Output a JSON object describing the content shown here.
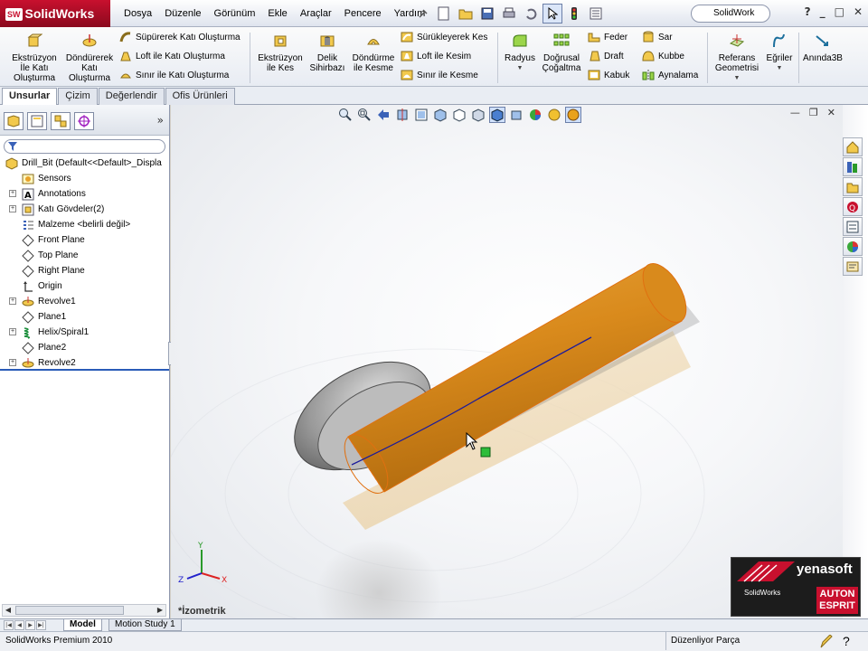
{
  "app": {
    "brand": "SolidWorks",
    "brand_badge": "SW",
    "menu": [
      "Dosya",
      "Düzenle",
      "Görünüm",
      "Ekle",
      "Araçlar",
      "Pencere",
      "Yardım"
    ],
    "search_placeholder": "SolidWork",
    "help_label": "?",
    "window_buttons": [
      "_",
      "□",
      "✕"
    ]
  },
  "commands": {
    "extrude_boss": "Ekstrüzyon İle Katı Oluşturma",
    "revolve_boss": "Döndürerek Katı Oluşturma",
    "sweep_boss": "Süpürerek Katı Oluşturma",
    "loft_boss": "Loft ile Katı Oluşturma",
    "boundary_boss": "Sınır ile Katı Oluşturma",
    "extrude_cut": "Ekstrüzyon ile Kes",
    "hole_wizard": "Delik Sihirbazı",
    "revolve_cut": "Döndürme ile Kesme",
    "sweep_cut": "Sürükleyerek Kes",
    "loft_cut": "Loft ile Kesim",
    "boundary_cut": "Sınır ile Kesme",
    "fillet": "Radyus",
    "linear_pattern": "Doğrusal Çoğaltma",
    "rib": "Feder",
    "draft": "Draft",
    "shell": "Kabuk",
    "wrap": "Sar",
    "dome": "Kubbe",
    "mirror": "Aynalama",
    "reference_geometry": "Referans Geometrisi",
    "curves": "Eğriler",
    "instant3d": "Anında3B"
  },
  "tabs": [
    "Unsurlar",
    "Çizim",
    "Değerlendir",
    "Ofis Ürünleri"
  ],
  "active_tab": "Unsurlar",
  "tree": {
    "root": "Drill_Bit  (Default<<Default>_Displa",
    "items": [
      {
        "label": "Sensors",
        "expandable": false
      },
      {
        "label": "Annotations",
        "expandable": true
      },
      {
        "label": "Katı Gövdeler(2)",
        "expandable": true
      },
      {
        "label": "Malzeme <belirli değil>",
        "expandable": false
      },
      {
        "label": "Front Plane",
        "expandable": false
      },
      {
        "label": "Top Plane",
        "expandable": false
      },
      {
        "label": "Right Plane",
        "expandable": false
      },
      {
        "label": "Origin",
        "expandable": false
      },
      {
        "label": "Revolve1",
        "expandable": true
      },
      {
        "label": "Plane1",
        "expandable": false
      },
      {
        "label": "Helix/Spiral1",
        "expandable": true
      },
      {
        "label": "Plane2",
        "expandable": false
      },
      {
        "label": "Revolve2",
        "expandable": true
      }
    ]
  },
  "viewport": {
    "view_name": "*İzometrik",
    "triad_labels": {
      "x": "X",
      "y": "Y",
      "z": "Z"
    }
  },
  "bottom_tabs": [
    "Model",
    "Motion Study 1"
  ],
  "status": {
    "version": "SolidWorks Premium 2010",
    "mode": "Düzenliyor Parça"
  },
  "watermark": {
    "company": "yenasoft",
    "sw_label": "SolidWorks",
    "partner_line1": "AUTON",
    "partner_line2": "ESPRIT"
  },
  "colors": {
    "brand_red": "#c8102e",
    "part_orange": "#d98a1c",
    "helix_blue": "#1a1a9c"
  }
}
